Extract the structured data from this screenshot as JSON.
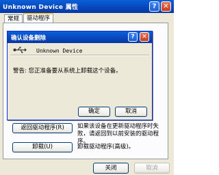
{
  "outer": {
    "title": "Unknown Device 属性",
    "help_glyph": "?",
    "close_glyph": "✕",
    "tabs": [
      "常规",
      "驱动程序"
    ]
  },
  "panel": {
    "rollback_button": "返回驱动程序(R)",
    "rollback_desc": "如果该设备在更新驱动程序时失败，请返回到以前安装的驱动程序。",
    "uninstall_button": "卸载(U)",
    "uninstall_desc": "卸载驱动程序(高级)。"
  },
  "footer": {
    "close_button": "关闭",
    "cancel_button": "取消"
  },
  "dialog": {
    "title": "确认设备删除",
    "help_glyph": "?",
    "close_glyph": "✕",
    "device_name": "Unknown Device",
    "warning": "警告: 您正准备要从系统上卸载这个设备。",
    "ok_button": "确定",
    "cancel_button": "取消"
  }
}
